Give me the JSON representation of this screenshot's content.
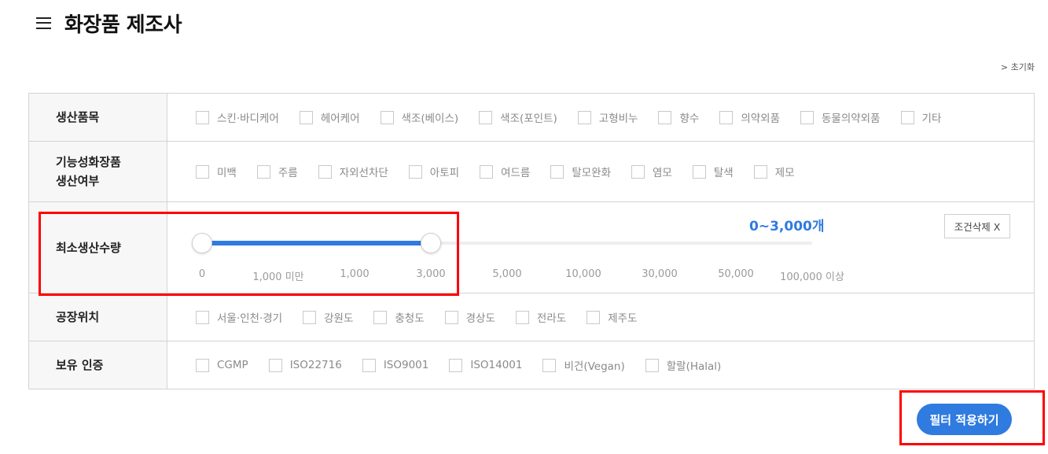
{
  "header": {
    "title": "화장품 제조사",
    "menu_icon": "hamburger-menu-icon"
  },
  "reset_link": "> 초기화",
  "filters": {
    "production_items": {
      "label": "생산품목",
      "options": [
        "스킨·바디케어",
        "헤어케어",
        "색조(베이스)",
        "색조(포인트)",
        "고형비누",
        "향수",
        "의약외품",
        "동물의약외품",
        "기타"
      ]
    },
    "functional_cosmetics": {
      "label_line1": "기능성화장품",
      "label_line2": "생산여부",
      "options": [
        "미백",
        "주름",
        "자외선차단",
        "아토피",
        "여드름",
        "탈모완화",
        "염모",
        "탈색",
        "제모"
      ]
    },
    "min_quantity": {
      "label": "최소생산수량",
      "range_display": "0~3,000개",
      "clear_label": "조건삭제 X",
      "ticks": [
        "0",
        "1,000 미만",
        "1,000",
        "3,000",
        "5,000",
        "10,000",
        "30,000",
        "50,000",
        "100,000 이상"
      ],
      "selected_min_index": 0,
      "selected_max_index": 3
    },
    "factory_location": {
      "label": "공장위치",
      "options": [
        "서울·인천·경기",
        "강원도",
        "충청도",
        "경상도",
        "전라도",
        "제주도"
      ]
    },
    "certifications": {
      "label": "보유 인증",
      "options": [
        "CGMP",
        "ISO22716",
        "ISO9001",
        "ISO14001",
        "비건(Vegan)",
        "할랄(Halal)"
      ]
    }
  },
  "apply_button": "필터 적용하기",
  "colors": {
    "accent": "#2f7be0",
    "highlight": "#ff0000"
  }
}
